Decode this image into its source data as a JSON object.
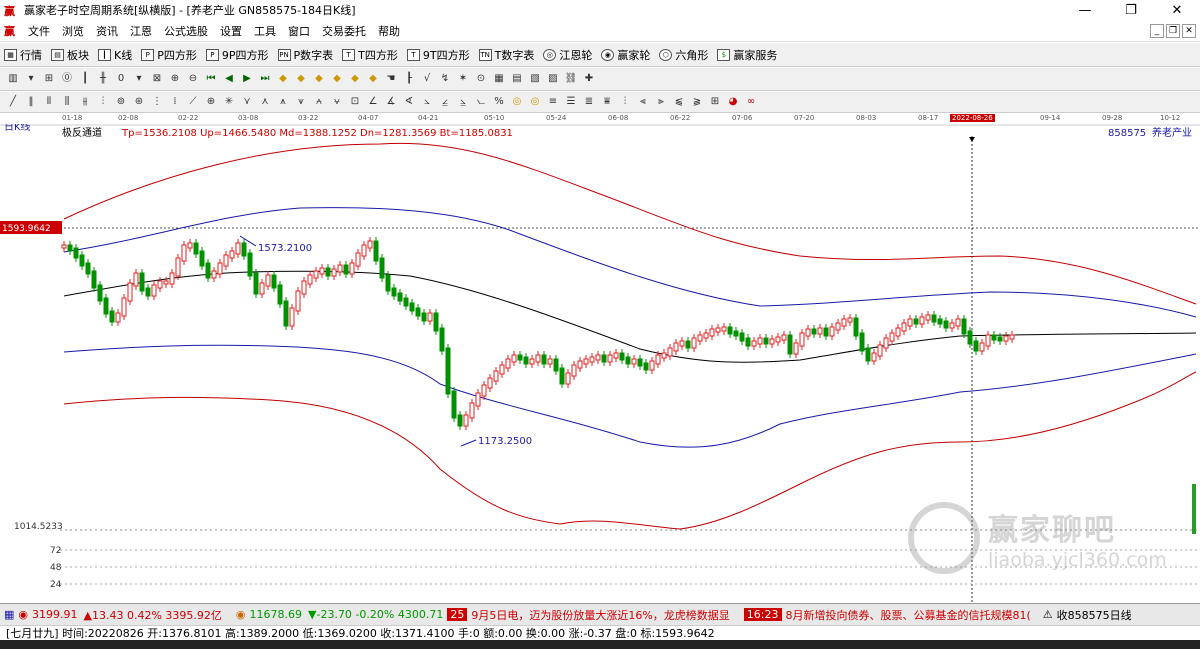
{
  "window": {
    "title": "赢家老子时空周期系统[纵横版] - [养老产业  GN858575-184日K线]",
    "controls": [
      "—",
      "❐",
      "✕"
    ]
  },
  "menu": {
    "items": [
      "文件",
      "浏览",
      "资讯",
      "江恩",
      "公式选股",
      "设置",
      "工具",
      "窗口",
      "交易委托",
      "帮助"
    ]
  },
  "toolbar1": {
    "items": [
      "行情",
      "板块",
      "K线",
      "P四方形",
      "9P四方形",
      "P数字表",
      "T四方形",
      "9T四方形",
      "T数字表",
      "江恩轮",
      "赢家轮",
      "六角形",
      "赢家服务"
    ]
  },
  "dates": {
    "labels": [
      "01-18",
      "02-08",
      "02-22",
      "03-08",
      "03-22",
      "04-07",
      "04-21",
      "05-10",
      "05-24",
      "06-08",
      "06-22",
      "07-06",
      "07-20",
      "08-03",
      "08-17",
      "2022-08-26",
      "09-14",
      "09-28",
      "10-12"
    ],
    "highlight": "2022-08-26"
  },
  "chart_data": {
    "type": "candlestick",
    "period_label": "日K线",
    "indicator_name": "极反通道",
    "indicator_values": "Tp=1536.2108  Up=1466.5480  Md=1388.1252  Dn=1281.3569  Bt=1185.0831",
    "code_label": "858575",
    "name_label": "养老产业",
    "price_marker": "1593.9642",
    "high_label": "1573.2100",
    "low_label": "1173.2500",
    "bottom_axis": "1014.5233",
    "volume_ticks": [
      "72",
      "48",
      "24"
    ],
    "ylim": [
      1014.5233,
      1600
    ]
  },
  "status": {
    "idx1_val": "3199.91",
    "idx1_chg": "▲13.43 0.42% 3395.92亿",
    "idx2_val": "11678.69",
    "idx2_chg": "▼-23.70 -0.20% 4300.71",
    "time1": "25",
    "news1": "9月5日电，迈为股份放量大涨近16%，龙虎榜数据显",
    "time2": "16:23",
    "news2": "8月新增投向债券、股票、公募基金的信托规模81(",
    "right": "收858575日线"
  },
  "quote": {
    "text": "[七月廿九] 时间:20220826 开:1376.8101 高:1389.2000 低:1369.0200 收:1371.4100 手:0 额:0.00 换:0.00 涨:-0.37 盘:0 标:1593.9642"
  },
  "watermark": {
    "brand": "赢家聊吧",
    "url": "liaoba.yjcl360.com"
  },
  "colors": {
    "up": "#e02020",
    "down": "#009000",
    "upper_band": "#c00000",
    "inner_band": "#1a1aa8",
    "mid_line": "#000000"
  }
}
